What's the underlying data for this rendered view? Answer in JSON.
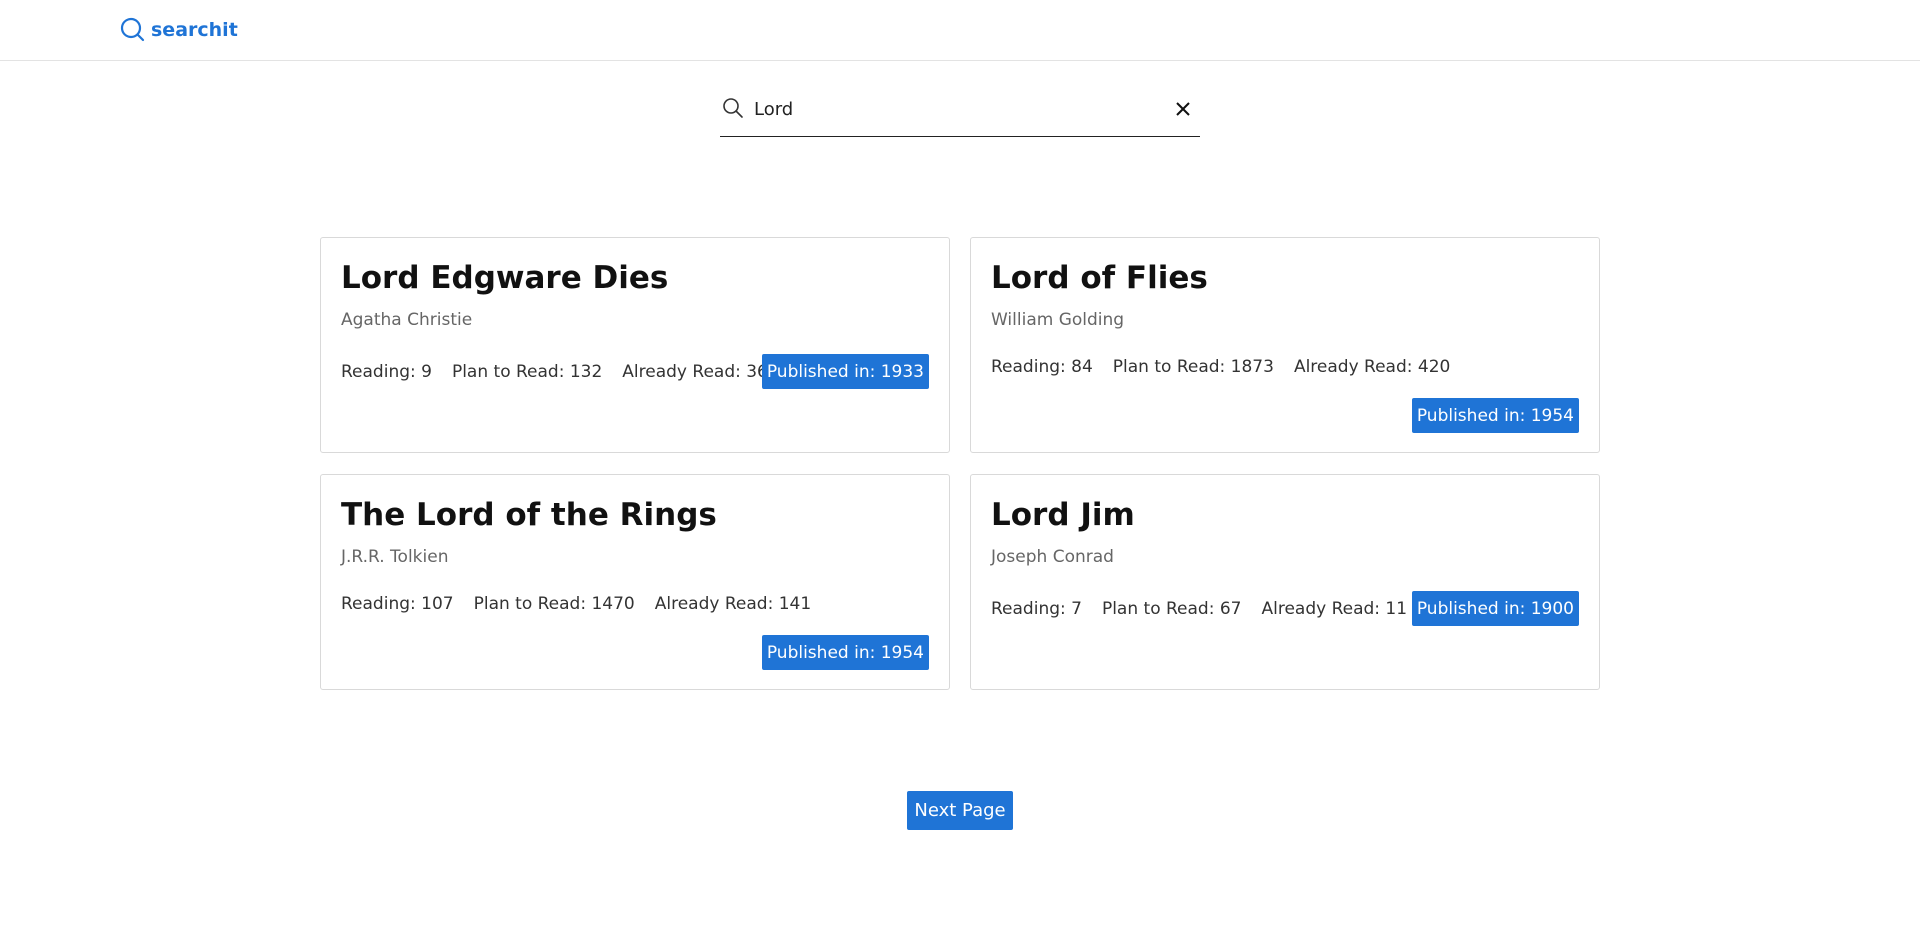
{
  "app": {
    "brand_label": "searchit",
    "accent_color": "#1f74d6",
    "brand_icon": "search-icon"
  },
  "search": {
    "value": "Lord",
    "icon": "search-icon",
    "clear_icon": "close-icon"
  },
  "results": [
    {
      "title": "Lord Edgware Dies",
      "author": "Agatha Christie",
      "reading": "Reading: 9",
      "plan_to_read": "Plan to Read: 132",
      "already_read": "Already Read: 36",
      "published": "Published in: 1933"
    },
    {
      "title": "Lord of Flies",
      "author": "William Golding",
      "reading": "Reading: 84",
      "plan_to_read": "Plan to Read: 1873",
      "already_read": "Already Read: 420",
      "published": "Published in: 1954"
    },
    {
      "title": "The Lord of the Rings",
      "author": "J.R.R. Tolkien",
      "reading": "Reading: 107",
      "plan_to_read": "Plan to Read: 1470",
      "already_read": "Already Read: 141",
      "published": "Published in: 1954"
    },
    {
      "title": "Lord Jim",
      "author": "Joseph Conrad",
      "reading": "Reading: 7",
      "plan_to_read": "Plan to Read: 67",
      "already_read": "Already Read: 11",
      "published": "Published in: 1900"
    }
  ],
  "pagination": {
    "next_label": "Next Page"
  }
}
